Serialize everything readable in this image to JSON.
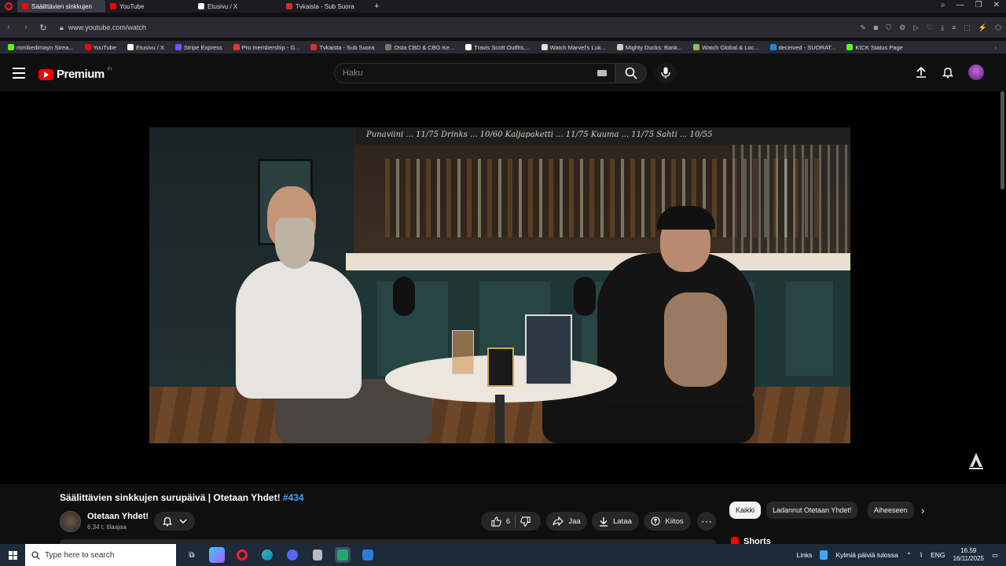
{
  "browser": {
    "tabs": [
      {
        "label": "Säälittävien sinkkujen",
        "color": "#ff0000",
        "active": true
      },
      {
        "label": "YouTube",
        "color": "#ff0000",
        "active": false
      },
      {
        "label": "Etusivu / X",
        "color": "#ffffff",
        "active": false
      },
      {
        "label": "Tvkaista - Sub Suora",
        "color": "#d32f2f",
        "active": false
      }
    ],
    "url": "www.youtube.com/watch",
    "bookmarks": [
      {
        "label": "mmikedimayn Strea...",
        "color": "#53fc18"
      },
      {
        "label": "YouTube",
        "color": "#ff0000"
      },
      {
        "label": "Etusivu / X",
        "color": "#ffffff"
      },
      {
        "label": "Stripe Express",
        "color": "#635bff"
      },
      {
        "label": "Pro membership - G...",
        "color": "#e53935"
      },
      {
        "label": "Tvkaista - Sub Suora",
        "color": "#d32f2f"
      },
      {
        "label": "Osta CBD & CBG Ke...",
        "color": "#777777"
      },
      {
        "label": "Travis Scott Outfits,...",
        "color": "#ffffff"
      },
      {
        "label": "Watch Marvel's Luk...",
        "color": "#dddddd"
      },
      {
        "label": "Mighty Ducks: Bank...",
        "color": "#cccccc"
      },
      {
        "label": "Watch Global & Loc...",
        "color": "#8bc34a"
      },
      {
        "label": "deceived - SUORAT...",
        "color": "#1e88e5"
      },
      {
        "label": "KICK Status Page",
        "color": "#53fc18"
      }
    ]
  },
  "masthead": {
    "brand": "Premium",
    "country": "FI",
    "search_placeholder": "Haku"
  },
  "video": {
    "title_main": "Säälittävien sinkkujen surupäivä | Otetaan Yhdet!",
    "title_hash": "#434",
    "channel": "Otetaan Yhdet!",
    "subscribers": "6,34 t. tilaajaa",
    "likes": "6",
    "share_label": "Jaa",
    "download_label": "Lataa",
    "thanks_label": "Kiitos",
    "chalkboard": "Punaviini ... 11/75    Drinks ... 10/60    Kaljapaketti ... 11/75    Kuuma ... 11/75    Sahti ... 10/55"
  },
  "chips": [
    {
      "label": "Kaikki",
      "selected": true
    },
    {
      "label": "Ladannut Otetaan Yhdet!",
      "selected": false
    },
    {
      "label": "Aiheeseen",
      "selected": false
    }
  ],
  "shorts_label": "Shorts",
  "taskbar": {
    "search_placeholder": "Type here to search",
    "links_label": "Links",
    "weather": "Kylmiä päiviä tulossa",
    "language": "ENG",
    "time": "16.59",
    "date": "16/11/2025"
  }
}
